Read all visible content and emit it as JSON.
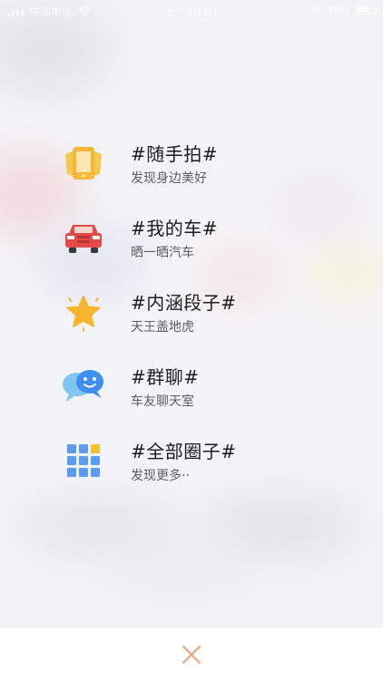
{
  "status_bar": {
    "carrier": "中国电信",
    "time": "上午10:03",
    "battery": "49%"
  },
  "menu": {
    "items": [
      {
        "title": "#随手拍#",
        "subtitle": "发现身边美好",
        "icon": "phone-camera-icon"
      },
      {
        "title": "#我的车#",
        "subtitle": "晒一晒汽车",
        "icon": "car-icon"
      },
      {
        "title": "#内涵段子#",
        "subtitle": "天王盖地虎",
        "icon": "star-icon"
      },
      {
        "title": "#群聊#",
        "subtitle": "车友聊天室",
        "icon": "chat-bubbles-icon"
      },
      {
        "title": "#全部圈子#",
        "subtitle": "发现更多··",
        "icon": "grid-icon"
      }
    ]
  },
  "bottom": {
    "close_icon": "close-icon"
  },
  "colors": {
    "phone_icon": "#f5b83a",
    "car_icon": "#e24a4a",
    "star_icon": "#f6b52c",
    "chat_light": "#7fc6f2",
    "chat_dark": "#3f8ff0",
    "grid_blue": "#5a9cf2",
    "grid_yellow": "#f6c131",
    "close": "#f0a17a"
  }
}
